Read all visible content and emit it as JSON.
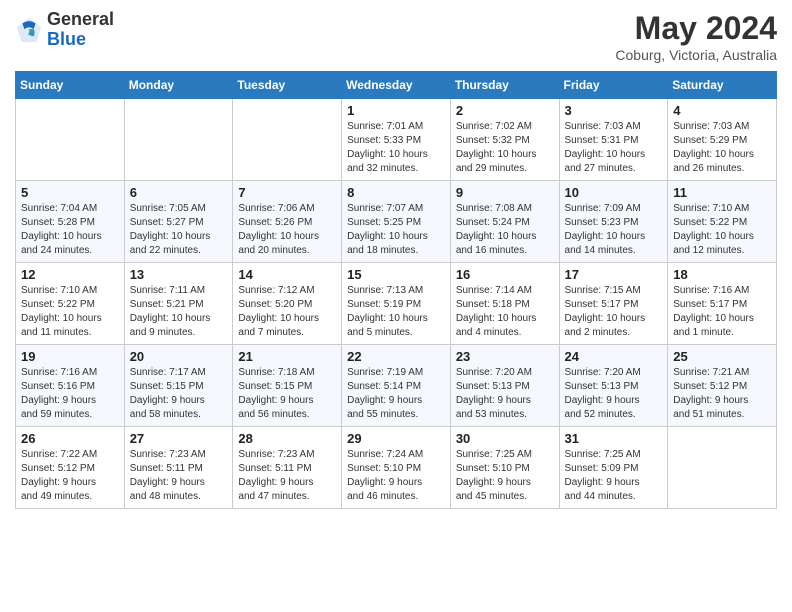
{
  "header": {
    "logo_line1": "General",
    "logo_line2": "Blue",
    "month_title": "May 2024",
    "location": "Coburg, Victoria, Australia"
  },
  "weekdays": [
    "Sunday",
    "Monday",
    "Tuesday",
    "Wednesday",
    "Thursday",
    "Friday",
    "Saturday"
  ],
  "weeks": [
    [
      {
        "day": "",
        "info": ""
      },
      {
        "day": "",
        "info": ""
      },
      {
        "day": "",
        "info": ""
      },
      {
        "day": "1",
        "info": "Sunrise: 7:01 AM\nSunset: 5:33 PM\nDaylight: 10 hours\nand 32 minutes."
      },
      {
        "day": "2",
        "info": "Sunrise: 7:02 AM\nSunset: 5:32 PM\nDaylight: 10 hours\nand 29 minutes."
      },
      {
        "day": "3",
        "info": "Sunrise: 7:03 AM\nSunset: 5:31 PM\nDaylight: 10 hours\nand 27 minutes."
      },
      {
        "day": "4",
        "info": "Sunrise: 7:03 AM\nSunset: 5:29 PM\nDaylight: 10 hours\nand 26 minutes."
      }
    ],
    [
      {
        "day": "5",
        "info": "Sunrise: 7:04 AM\nSunset: 5:28 PM\nDaylight: 10 hours\nand 24 minutes."
      },
      {
        "day": "6",
        "info": "Sunrise: 7:05 AM\nSunset: 5:27 PM\nDaylight: 10 hours\nand 22 minutes."
      },
      {
        "day": "7",
        "info": "Sunrise: 7:06 AM\nSunset: 5:26 PM\nDaylight: 10 hours\nand 20 minutes."
      },
      {
        "day": "8",
        "info": "Sunrise: 7:07 AM\nSunset: 5:25 PM\nDaylight: 10 hours\nand 18 minutes."
      },
      {
        "day": "9",
        "info": "Sunrise: 7:08 AM\nSunset: 5:24 PM\nDaylight: 10 hours\nand 16 minutes."
      },
      {
        "day": "10",
        "info": "Sunrise: 7:09 AM\nSunset: 5:23 PM\nDaylight: 10 hours\nand 14 minutes."
      },
      {
        "day": "11",
        "info": "Sunrise: 7:10 AM\nSunset: 5:22 PM\nDaylight: 10 hours\nand 12 minutes."
      }
    ],
    [
      {
        "day": "12",
        "info": "Sunrise: 7:10 AM\nSunset: 5:22 PM\nDaylight: 10 hours\nand 11 minutes."
      },
      {
        "day": "13",
        "info": "Sunrise: 7:11 AM\nSunset: 5:21 PM\nDaylight: 10 hours\nand 9 minutes."
      },
      {
        "day": "14",
        "info": "Sunrise: 7:12 AM\nSunset: 5:20 PM\nDaylight: 10 hours\nand 7 minutes."
      },
      {
        "day": "15",
        "info": "Sunrise: 7:13 AM\nSunset: 5:19 PM\nDaylight: 10 hours\nand 5 minutes."
      },
      {
        "day": "16",
        "info": "Sunrise: 7:14 AM\nSunset: 5:18 PM\nDaylight: 10 hours\nand 4 minutes."
      },
      {
        "day": "17",
        "info": "Sunrise: 7:15 AM\nSunset: 5:17 PM\nDaylight: 10 hours\nand 2 minutes."
      },
      {
        "day": "18",
        "info": "Sunrise: 7:16 AM\nSunset: 5:17 PM\nDaylight: 10 hours\nand 1 minute."
      }
    ],
    [
      {
        "day": "19",
        "info": "Sunrise: 7:16 AM\nSunset: 5:16 PM\nDaylight: 9 hours\nand 59 minutes."
      },
      {
        "day": "20",
        "info": "Sunrise: 7:17 AM\nSunset: 5:15 PM\nDaylight: 9 hours\nand 58 minutes."
      },
      {
        "day": "21",
        "info": "Sunrise: 7:18 AM\nSunset: 5:15 PM\nDaylight: 9 hours\nand 56 minutes."
      },
      {
        "day": "22",
        "info": "Sunrise: 7:19 AM\nSunset: 5:14 PM\nDaylight: 9 hours\nand 55 minutes."
      },
      {
        "day": "23",
        "info": "Sunrise: 7:20 AM\nSunset: 5:13 PM\nDaylight: 9 hours\nand 53 minutes."
      },
      {
        "day": "24",
        "info": "Sunrise: 7:20 AM\nSunset: 5:13 PM\nDaylight: 9 hours\nand 52 minutes."
      },
      {
        "day": "25",
        "info": "Sunrise: 7:21 AM\nSunset: 5:12 PM\nDaylight: 9 hours\nand 51 minutes."
      }
    ],
    [
      {
        "day": "26",
        "info": "Sunrise: 7:22 AM\nSunset: 5:12 PM\nDaylight: 9 hours\nand 49 minutes."
      },
      {
        "day": "27",
        "info": "Sunrise: 7:23 AM\nSunset: 5:11 PM\nDaylight: 9 hours\nand 48 minutes."
      },
      {
        "day": "28",
        "info": "Sunrise: 7:23 AM\nSunset: 5:11 PM\nDaylight: 9 hours\nand 47 minutes."
      },
      {
        "day": "29",
        "info": "Sunrise: 7:24 AM\nSunset: 5:10 PM\nDaylight: 9 hours\nand 46 minutes."
      },
      {
        "day": "30",
        "info": "Sunrise: 7:25 AM\nSunset: 5:10 PM\nDaylight: 9 hours\nand 45 minutes."
      },
      {
        "day": "31",
        "info": "Sunrise: 7:25 AM\nSunset: 5:09 PM\nDaylight: 9 hours\nand 44 minutes."
      },
      {
        "day": "",
        "info": ""
      }
    ]
  ]
}
